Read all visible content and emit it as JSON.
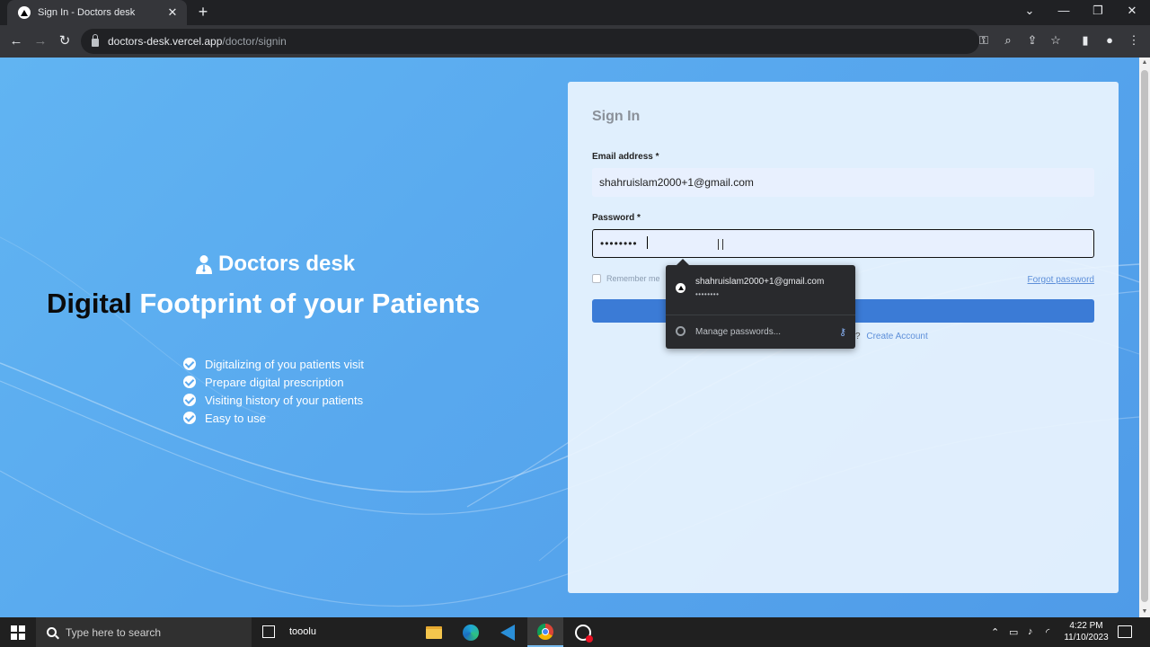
{
  "browser": {
    "tab_title": "Sign In - Doctors desk",
    "url_host": "doctors-desk.vercel.app",
    "url_path": "/doctor/signin"
  },
  "brand": {
    "name": "Doctors desk",
    "headline_dark": "Digital",
    "headline_light": "Footprint of your Patients"
  },
  "features": [
    "Digitalizing of you patients visit",
    "Prepare digital prescription",
    "Visiting history of your patients",
    "Easy to use"
  ],
  "form": {
    "title": "Sign In",
    "email_label": "Email address *",
    "email_value": "shahruislam2000+1@gmail.com",
    "password_label": "Password *",
    "password_value": "••••••••",
    "remember_label": "Remember me",
    "forgot_label": "Forgot password",
    "create_prefix": "?",
    "create_label": "Create Account"
  },
  "autofill": {
    "username": "shahruislam2000+1@gmail.com",
    "password_mask": "••••••••",
    "manage_label": "Manage passwords..."
  },
  "taskbar": {
    "search_placeholder": "Type here to search",
    "task_label": "tooolu",
    "time": "4:22 PM",
    "date": "11/10/2023"
  },
  "colors": {
    "page_gradient_start": "#61b4f2",
    "page_gradient_end": "#4f9be8",
    "primary_button": "#3b7bd6",
    "link": "#5d8fd9"
  }
}
